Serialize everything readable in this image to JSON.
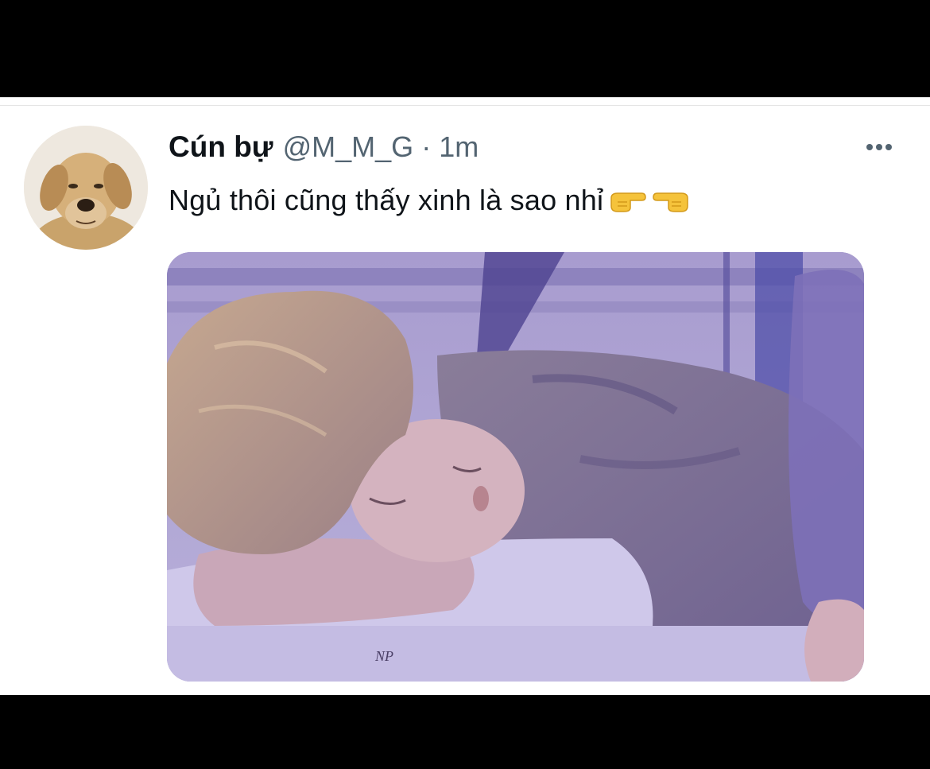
{
  "tweet": {
    "display_name": "Cún bự",
    "handle": "@M_M_G",
    "separator": "·",
    "time": "1m",
    "text": "Ngủ thôi cũng thấy xinh là sao nhỉ",
    "emojis": [
      "backhand-index-pointing-right",
      "backhand-index-pointing-left"
    ],
    "avatar": "golden-retriever-photo",
    "media": "sleeping-person-photo"
  },
  "colors": {
    "name": "#0f1419",
    "secondary": "#536471",
    "background": "#ffffff"
  }
}
